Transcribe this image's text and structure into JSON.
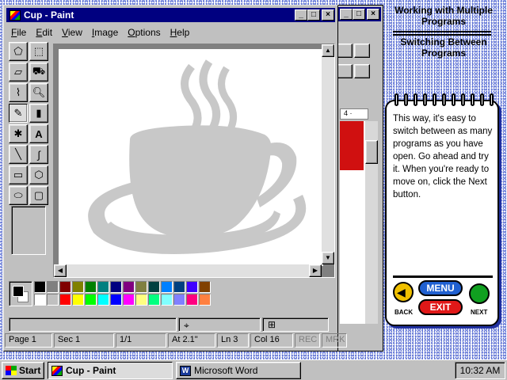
{
  "word_window": {
    "ruler_text": "4 ·"
  },
  "paint_window": {
    "title": "Cup - Paint",
    "controls": {
      "minimize": "_",
      "maximize": "□",
      "close": "×"
    },
    "menu": [
      "File",
      "Edit",
      "View",
      "Image",
      "Options",
      "Help"
    ],
    "menu_underline": [
      "F",
      "E",
      "V",
      "I",
      "O",
      "H"
    ],
    "tools": [
      {
        "name": "free-form-select",
        "glyph": "⬠"
      },
      {
        "name": "select",
        "glyph": "⬚"
      },
      {
        "name": "eraser",
        "glyph": "▱"
      },
      {
        "name": "fill",
        "glyph": "⛟"
      },
      {
        "name": "pick-color",
        "glyph": "⌇"
      },
      {
        "name": "magnifier",
        "glyph": "🔍︎"
      },
      {
        "name": "pencil",
        "glyph": "✎"
      },
      {
        "name": "brush",
        "glyph": "▮"
      },
      {
        "name": "airbrush",
        "glyph": "✱"
      },
      {
        "name": "text",
        "glyph": "A"
      },
      {
        "name": "line",
        "glyph": "╲"
      },
      {
        "name": "curve",
        "glyph": "∫"
      },
      {
        "name": "rectangle",
        "glyph": "▭"
      },
      {
        "name": "polygon",
        "glyph": "⬡"
      },
      {
        "name": "ellipse",
        "glyph": "⬭"
      },
      {
        "name": "rounded-rectangle",
        "glyph": "▢"
      }
    ],
    "palette_top": [
      "#000000",
      "#808080",
      "#800000",
      "#808000",
      "#008000",
      "#008080",
      "#000080",
      "#800080",
      "#808040",
      "#004040",
      "#0080ff",
      "#004080",
      "#4000ff",
      "#804000"
    ],
    "palette_bottom": [
      "#ffffff",
      "#c0c0c0",
      "#ff0000",
      "#ffff00",
      "#00ff00",
      "#00ffff",
      "#0000ff",
      "#ff00ff",
      "#ffff80",
      "#00ff80",
      "#80ffff",
      "#8080ff",
      "#ff0080",
      "#ff8040"
    ],
    "foreground": "#000000",
    "background": "#ffffff",
    "cup_color": "#c8c8c8"
  },
  "word_status": {
    "page": "Page 1",
    "sec": "Sec 1",
    "pages": "1/1",
    "at": "At 2.1\"",
    "ln": "Ln 3",
    "col": "Col 16",
    "rec": "REC",
    "mrk": "MRK"
  },
  "help": {
    "heading_1": "Working with Multiple Programs",
    "heading_2": "Switching Between Programs",
    "body": "This way, it's easy to switch between as many programs as you have open.  Go ahead and try it.  When you're ready to move on, click the Next button.",
    "menu_label": "MENU",
    "exit_label": "EXIT",
    "back_label": "BACK",
    "next_label": "NEXT",
    "menu_color": "#2060d0",
    "exit_color": "#e01818",
    "back_color": "#f0c000",
    "next_color": "#10a020"
  },
  "taskbar": {
    "start": "Start",
    "tasks": [
      {
        "label": "Cup  - Paint",
        "active": true
      },
      {
        "label": "Microsoft Word",
        "active": false
      }
    ],
    "clock": "10:32 AM"
  }
}
